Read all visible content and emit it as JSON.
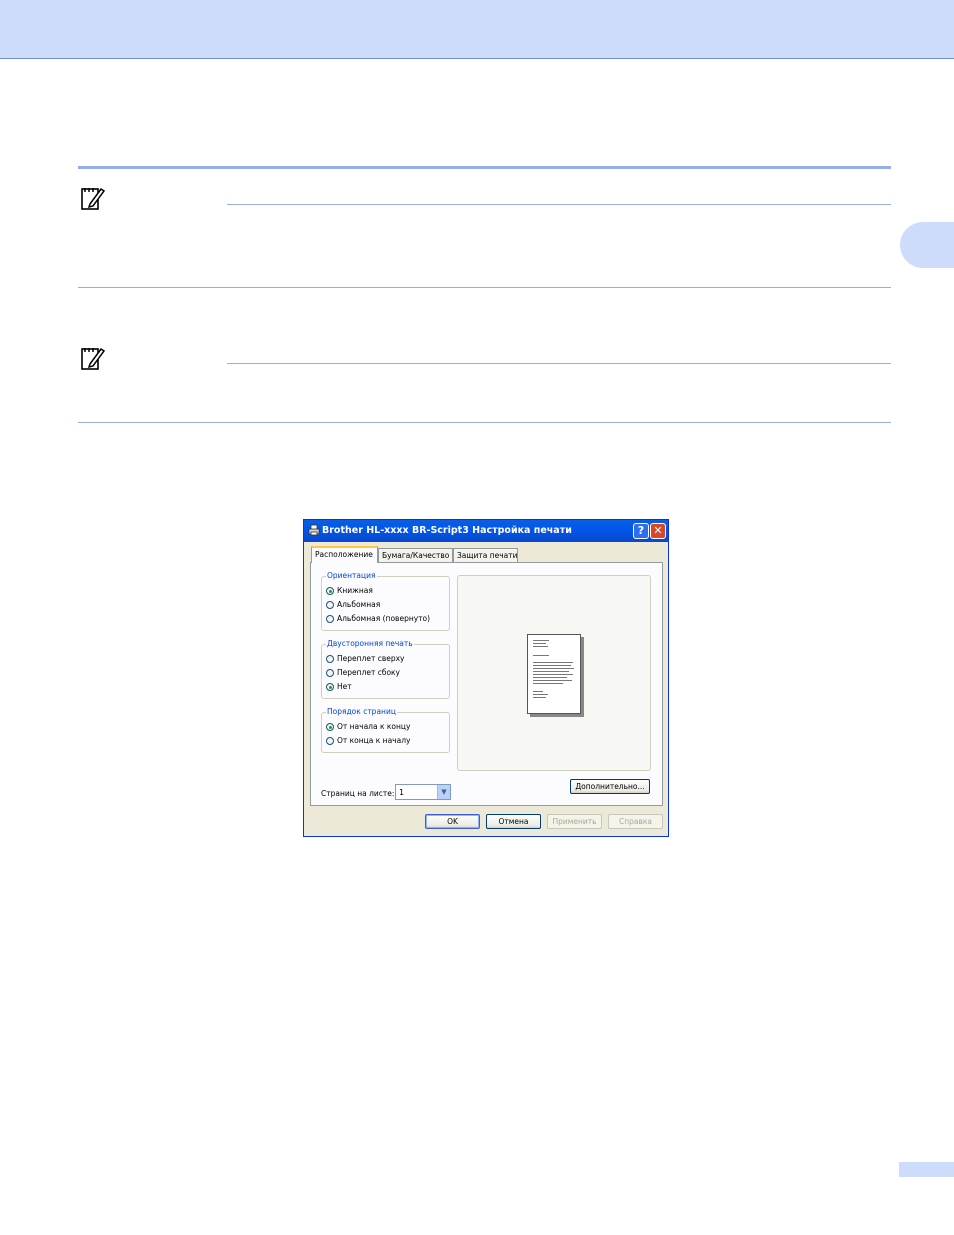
{
  "dialog": {
    "title": "Brother HL-xxxx BR-Script3 Настройка печати",
    "help_glyph": "?",
    "close_glyph": "✕",
    "tabs": [
      {
        "label": "Расположение",
        "active": true
      },
      {
        "label": "Бумага/Качество",
        "active": false
      },
      {
        "label": "Защита печати",
        "active": false
      }
    ],
    "orientation": {
      "title": "Ориентация",
      "options": [
        {
          "label": "Книжная",
          "selected": true
        },
        {
          "label": "Альбомная",
          "selected": false
        },
        {
          "label": "Альбомная (повернуто)",
          "selected": false
        }
      ]
    },
    "duplex": {
      "title": "Двусторонняя печать",
      "options": [
        {
          "label": "Переплет сверху",
          "selected": false
        },
        {
          "label": "Переплет сбоку",
          "selected": false
        },
        {
          "label": "Нет",
          "selected": true
        }
      ]
    },
    "page_order": {
      "title": "Порядок страниц",
      "options": [
        {
          "label": "От начала к концу",
          "selected": true
        },
        {
          "label": "От конца к началу",
          "selected": false
        }
      ]
    },
    "pages_per_sheet": {
      "label": "Страниц на листе:",
      "value": "1"
    },
    "advanced_button": "Дополнительно...",
    "buttons": {
      "ok": "OK",
      "cancel": "Отмена",
      "apply": "Применить",
      "help": "Справка"
    }
  },
  "colors": {
    "header_band": "#cddcfa",
    "rule": "#93aee8",
    "dialog_accent": "#0058ee"
  }
}
